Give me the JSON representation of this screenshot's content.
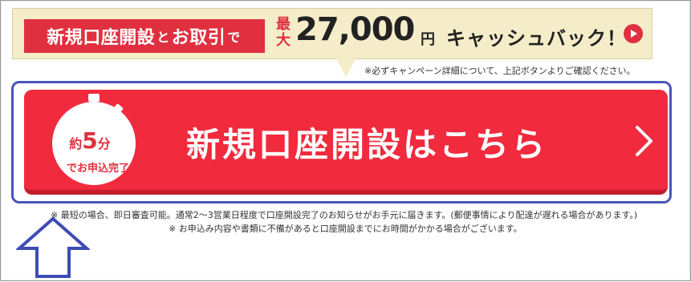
{
  "banner": {
    "tag_part1": "新規口座開設",
    "tag_connector1": "と",
    "tag_part2": "お取引",
    "tag_connector2": "で",
    "max_label": "最大",
    "amount": "27,000",
    "yen": "円",
    "cashback": "キャッシュバック！",
    "note": "※必ずキャンペーン詳細について、上記ボタンよりご確認ください。"
  },
  "cta": {
    "title": "新規口座開設はこちら",
    "badge_yaku": "約",
    "badge_five": "5",
    "badge_fun": "分",
    "badge_star": "※",
    "badge_line": "でお申込完了"
  },
  "notes": {
    "line1": "※ 最短の場合、即日審査可能。通常2〜3営業日程度で口座開設完了のお知らせがお手元に届きます。(郵便事情により配達が遅れる場合があります。)",
    "line2": "※ お申込み内容や書類に不備があると口座開設までにお時間がかかる場合がございます。"
  },
  "colors": {
    "accent_red": "#e0303f",
    "cta_red": "#f12a3d",
    "banner_bg": "#f5edc9",
    "highlight_blue": "#4a55b8"
  },
  "icons": {
    "play": "play-circle-icon",
    "chevron": "chevron-right-icon",
    "stopwatch": "stopwatch-icon",
    "annotation_arrow": "up-arrow-icon"
  }
}
